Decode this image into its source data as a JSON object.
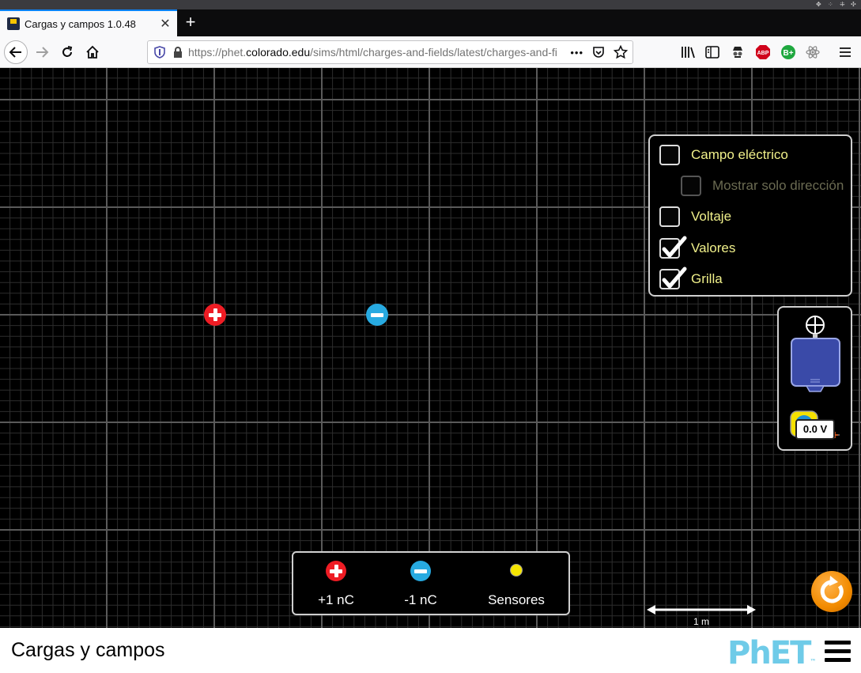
{
  "browser": {
    "tab_title": "Cargas y campos 1.0.48",
    "url_prefix": "https://phet.",
    "url_domain": "colorado.edu",
    "url_rest": "/sims/html/charges-and-fields/latest/charges-and-fi",
    "new_tab_label": "+",
    "tab_close_label": "✕",
    "more_label": "•••"
  },
  "controls": {
    "items": [
      {
        "label": "Campo eléctrico",
        "checked": false,
        "disabled": false
      },
      {
        "label": "Mostrar solo dirección",
        "checked": false,
        "disabled": true
      },
      {
        "label": "Voltaje",
        "checked": false,
        "disabled": false
      },
      {
        "label": "Valores",
        "checked": true,
        "disabled": false
      },
      {
        "label": "Grilla",
        "checked": true,
        "disabled": false
      }
    ]
  },
  "toolbox": {
    "voltmeter_reading": "0.0 V"
  },
  "charge_panel": {
    "positive_label": "+1 nC",
    "negative_label": "-1 nC",
    "sensors_label": "Sensores"
  },
  "scale": {
    "label": "1 m"
  },
  "phet": {
    "sim_title": "Cargas y campos",
    "logo_text": "PhET",
    "logo_tm": "™"
  },
  "colors": {
    "positive": "#ee1c24",
    "negative": "#27aae1",
    "label_yellow": "#f0f08a",
    "reset_orange": "#f28b00"
  }
}
